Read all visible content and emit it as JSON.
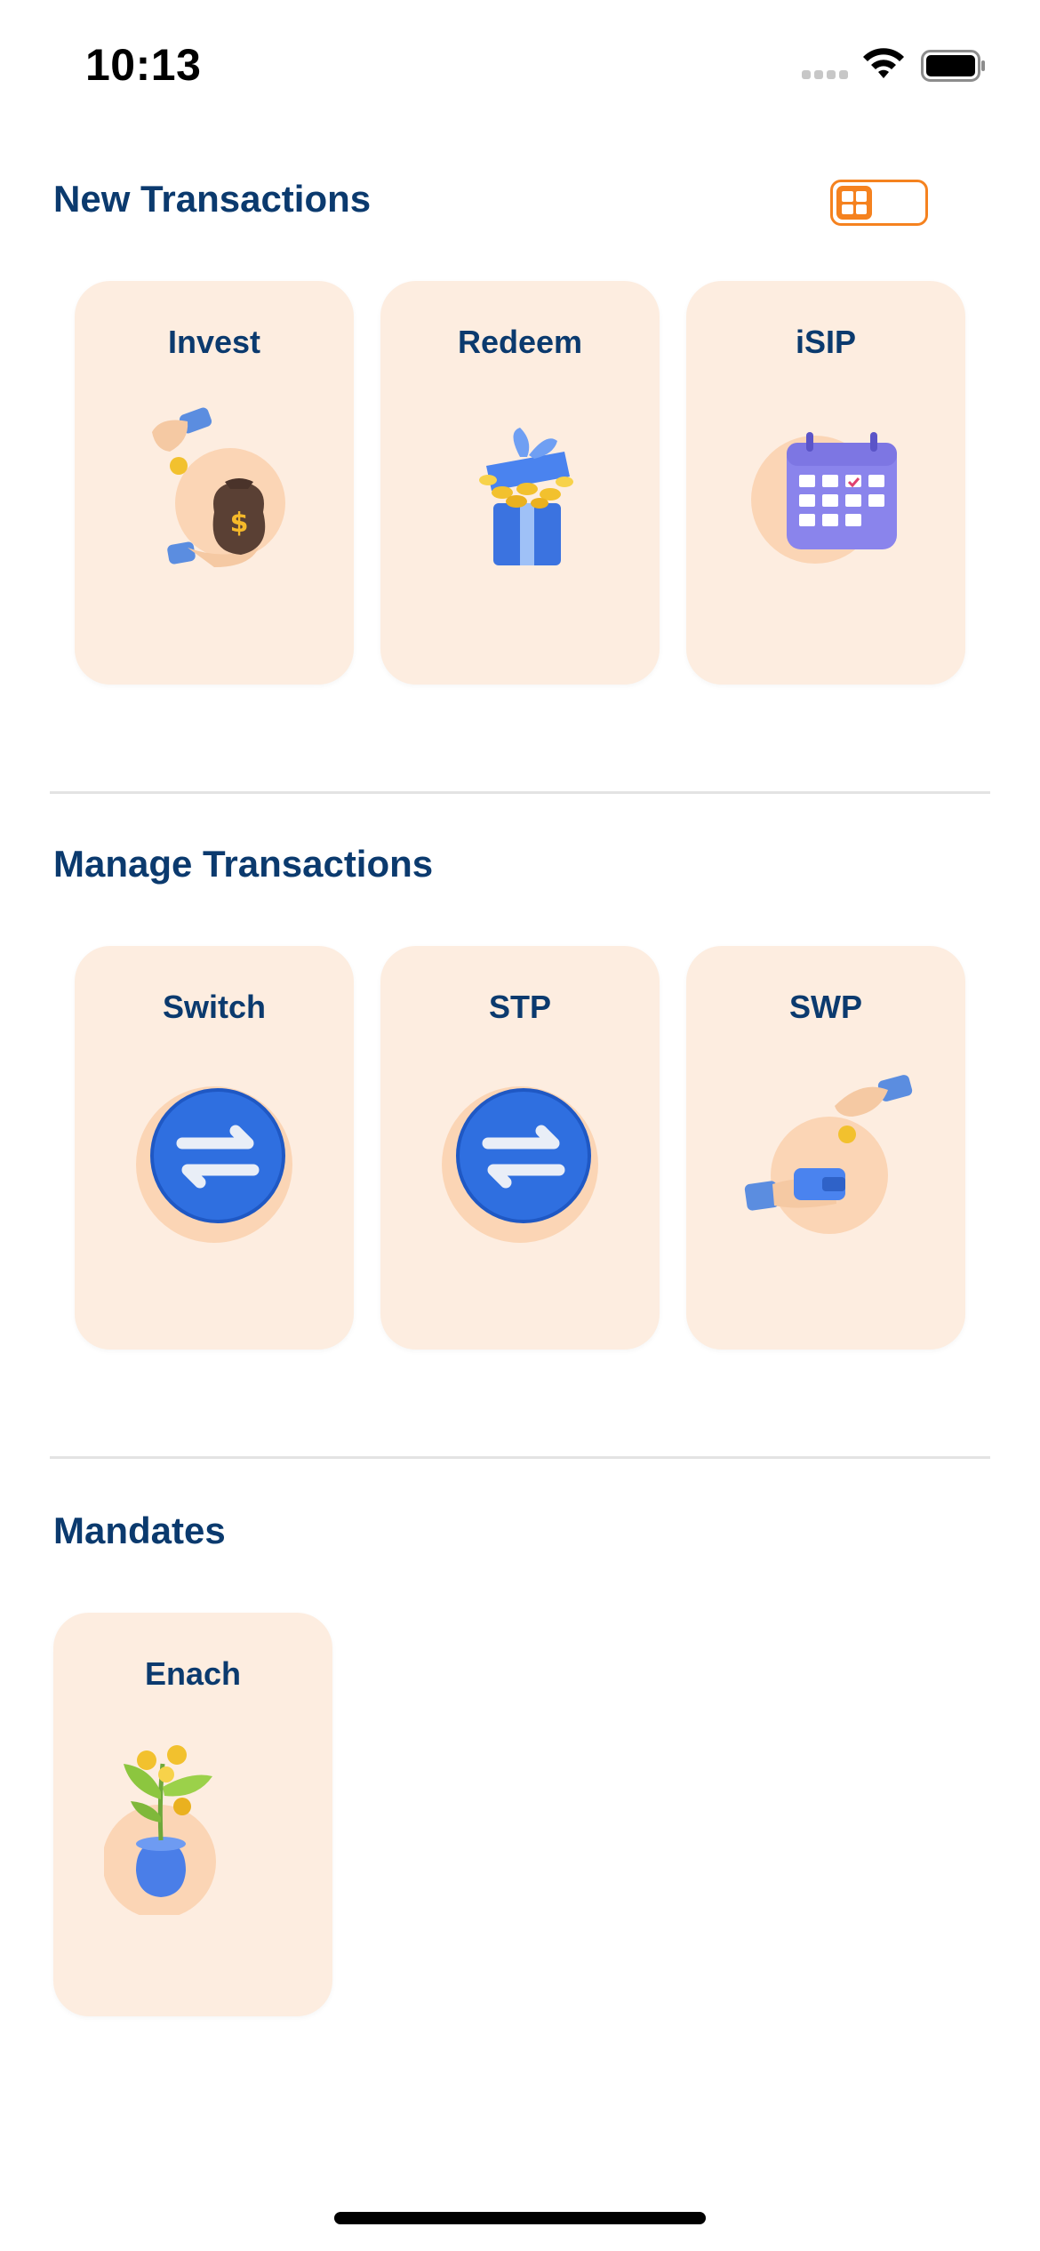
{
  "status_bar": {
    "time": "10:13"
  },
  "sections": {
    "new": {
      "title": "New Transactions",
      "cards": [
        {
          "label": "Invest"
        },
        {
          "label": "Redeem"
        },
        {
          "label": "iSIP"
        }
      ]
    },
    "manage": {
      "title": "Manage Transactions",
      "cards": [
        {
          "label": "Switch"
        },
        {
          "label": "STP"
        },
        {
          "label": "SWP"
        }
      ]
    },
    "mandates": {
      "title": "Mandates",
      "cards": [
        {
          "label": "Enach"
        }
      ]
    }
  },
  "icons": {
    "invest": "money-bag-hands-icon",
    "redeem": "gift-box-coins-icon",
    "isip": "calendar-icon",
    "switch": "swap-arrows-icon",
    "stp": "swap-arrows-icon",
    "swp": "hand-wallet-coin-icon",
    "enach": "money-plant-icon",
    "view_toggle": "grid-view-icon"
  },
  "colors": {
    "primary_text": "#0b3a6e",
    "accent": "#f5821f",
    "card_bg": "#fdede0"
  }
}
